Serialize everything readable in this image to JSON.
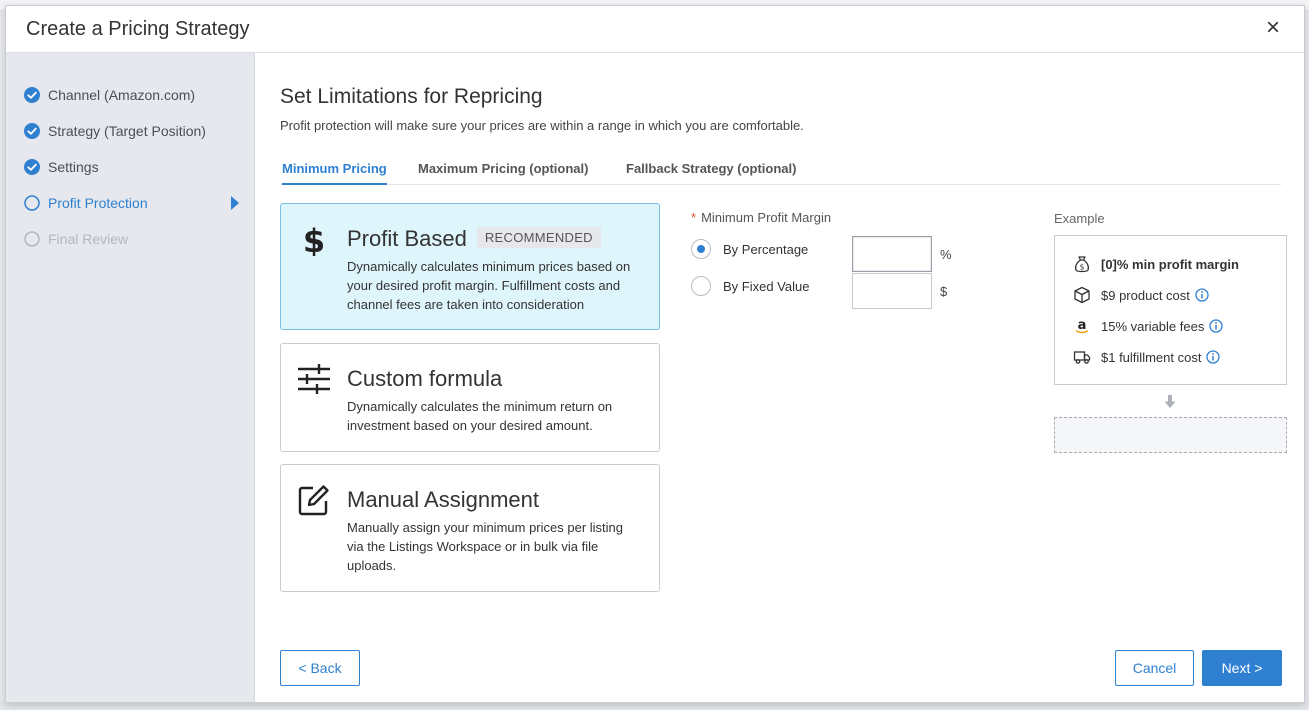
{
  "modal": {
    "title": "Create a Pricing Strategy",
    "close_glyph": "×"
  },
  "steps": [
    {
      "label": "Channel (Amazon.com)",
      "status": "done"
    },
    {
      "label": "Strategy (Target Position)",
      "status": "done"
    },
    {
      "label": "Settings",
      "status": "done"
    },
    {
      "label": "Profit Protection",
      "status": "active"
    },
    {
      "label": "Final Review",
      "status": "pending"
    }
  ],
  "section": {
    "title": "Set Limitations for Repricing",
    "subtitle": "Profit protection will make sure your prices are within a range in which you are comfortable."
  },
  "tabs": [
    {
      "label": "Minimum Pricing",
      "active": true
    },
    {
      "label": "Maximum Pricing (optional)",
      "active": false
    },
    {
      "label": "Fallback Strategy (optional)",
      "active": false
    }
  ],
  "cards": [
    {
      "icon": "dollar-icon",
      "title": "Profit Based",
      "badge": "RECOMMENDED",
      "description": "Dynamically calculates minimum prices based on your desired profit margin. Fulfillment costs and channel fees are taken into consideration",
      "selected": true
    },
    {
      "icon": "sliders-icon",
      "title": "Custom formula",
      "description": "Dynamically calculates the minimum return on investment based on your desired amount.",
      "selected": false
    },
    {
      "icon": "edit-icon",
      "title": "Manual Assignment",
      "description": "Manually assign your minimum prices per listing via the Listings Workspace or in bulk via file uploads.",
      "selected": false
    }
  ],
  "margin": {
    "required_mark": "*",
    "label": "Minimum Profit Margin",
    "options": [
      {
        "label": "By Percentage",
        "checked": true,
        "value": "",
        "unit": "%"
      },
      {
        "label": "By Fixed Value",
        "checked": false,
        "value": "",
        "unit": "$"
      }
    ]
  },
  "example": {
    "label": "Example",
    "rows": [
      {
        "icon": "money-bag-icon",
        "text": "[0]% min profit margin",
        "bold": true,
        "info": false
      },
      {
        "icon": "box-icon",
        "text": "$9 product cost",
        "bold": false,
        "info": true
      },
      {
        "icon": "amazon-icon",
        "text": "15% variable fees",
        "bold": false,
        "info": true
      },
      {
        "icon": "truck-icon",
        "text": "$1 fulfillment cost",
        "bold": false,
        "info": true
      }
    ],
    "result": ""
  },
  "buttons": {
    "back": "< Back",
    "cancel": "Cancel",
    "next": "Next >"
  },
  "colors": {
    "accent": "#2f80d1",
    "selected_card_bg": "#def5fb",
    "sidebar_bg": "#e6e8ed",
    "required": "#e4572e"
  }
}
